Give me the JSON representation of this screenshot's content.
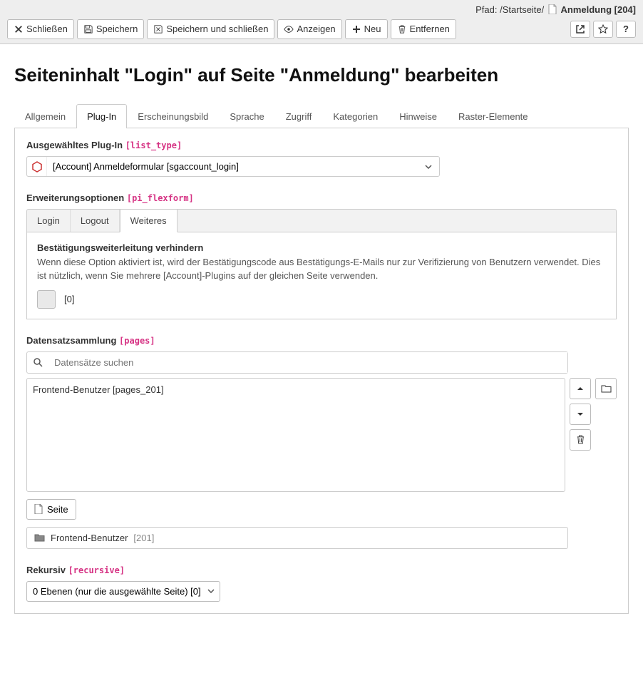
{
  "breadcrumb": {
    "prefix": "Pfad:",
    "root": "/Startseite/",
    "current": "Anmeldung",
    "id": "[204]"
  },
  "toolbar": {
    "close": "Schließen",
    "save": "Speichern",
    "save_close": "Speichern und schließen",
    "show": "Anzeigen",
    "new": "Neu",
    "delete": "Entfernen"
  },
  "page_title": "Seiteninhalt \"Login\" auf Seite \"Anmeldung\" bearbeiten",
  "tabs": [
    "Allgemein",
    "Plug-In",
    "Erscheinungsbild",
    "Sprache",
    "Zugriff",
    "Kategorien",
    "Hinweise",
    "Raster-Elemente"
  ],
  "tabs_active_index": 1,
  "plugin": {
    "label": "Ausgewähltes Plug-In",
    "tech": "[list_type]",
    "selected": "[Account] Anmeldeformular [sgaccount_login]"
  },
  "flex": {
    "label": "Erweiterungsoptionen",
    "tech": "[pi_flexform]",
    "subtabs": [
      "Login",
      "Logout",
      "Weiteres"
    ],
    "subtabs_active_index": 2,
    "option": {
      "title": "Bestätigungsweiterleitung verhindern",
      "desc": "Wenn diese Option aktiviert ist, wird der Bestätigungscode aus Bestätigungs-E-Mails nur zur Verifizierung von Benutzern verwendet. Dies ist nützlich, wenn Sie mehrere [Account]-Plugins auf der gleichen Seite verwenden.",
      "value_label": "[0]"
    }
  },
  "pages": {
    "label": "Datensatzsammlung",
    "tech": "[pages]",
    "search_placeholder": "Datensätze suchen",
    "items": [
      "Frontend-Benutzer [pages_201]"
    ],
    "page_button": "Seite",
    "record_name": "Frontend-Benutzer",
    "record_id": "[201]"
  },
  "recursive": {
    "label": "Rekursiv",
    "tech": "[recursive]",
    "selected": "0 Ebenen (nur die ausgewählte Seite) [0]"
  }
}
